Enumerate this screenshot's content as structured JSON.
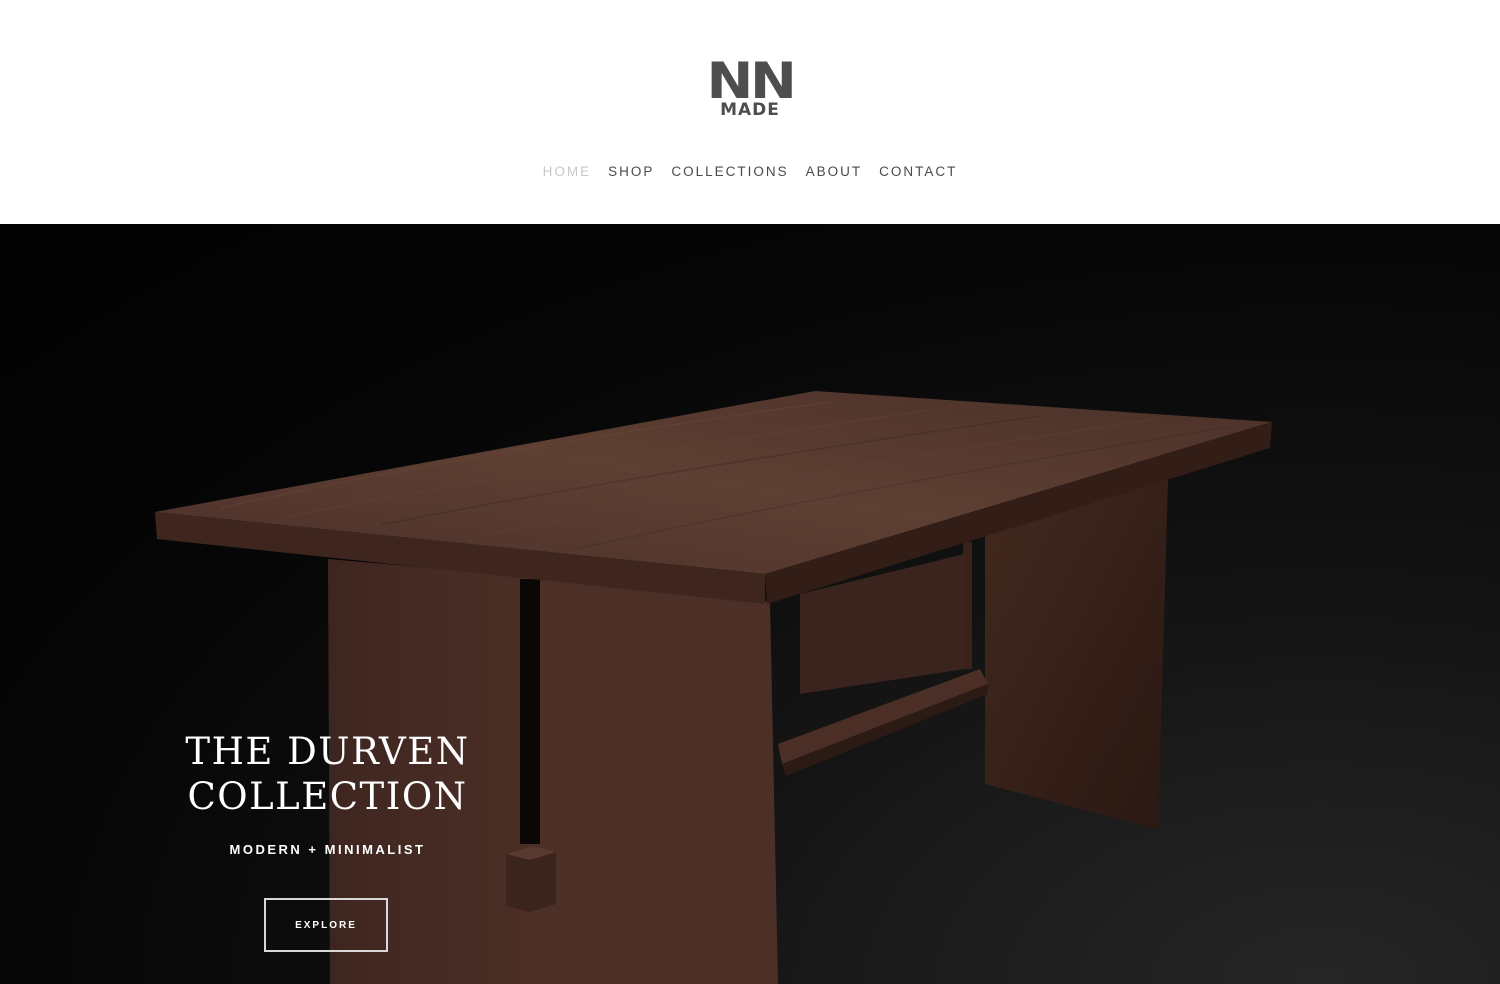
{
  "header": {
    "logo": {
      "top_text": "NN",
      "bottom_text": "MADE"
    },
    "nav": [
      {
        "label": "HOME",
        "active": true
      },
      {
        "label": "SHOP",
        "active": false
      },
      {
        "label": "COLLECTIONS",
        "active": false
      },
      {
        "label": "ABOUT",
        "active": false
      },
      {
        "label": "CONTACT",
        "active": false
      }
    ]
  },
  "hero": {
    "title_line1": "THE DURVEN",
    "title_line2": "COLLECTION",
    "subtitle": "MODERN + MINIMALIST",
    "button_label": "EXPLORE"
  },
  "colors": {
    "nav_text": "#4a4a4a",
    "nav_active": "#c9c9c9",
    "logo": "#4e4e4e",
    "hero_background": "#050505",
    "wood": "#5a3a2e"
  }
}
